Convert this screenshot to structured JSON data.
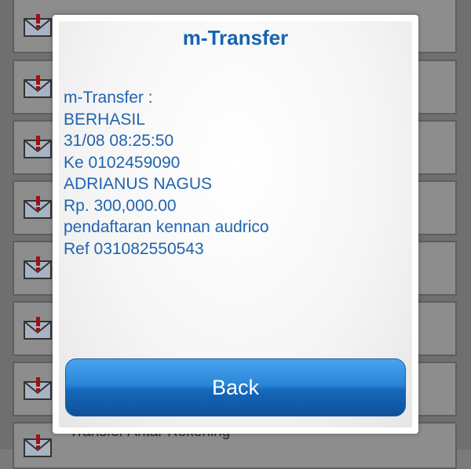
{
  "dialog": {
    "title": "m-Transfer",
    "message_lines": [
      "m-Transfer :",
      "BERHASIL",
      "31/08 08:25:50",
      "Ke 0102459090",
      "ADRIANUS NAGUS",
      "Rp. 300,000.00",
      "pendaftaran kennan audrico",
      "Ref 031082550543"
    ],
    "back_label": "Back"
  },
  "background_list": {
    "last_item_label": "Transfer Antar Rekening"
  },
  "colors": {
    "title": "#1863b0",
    "message_text": "#1f64b0",
    "button_top": "#4aa3ee",
    "button_bottom": "#10509a",
    "overlay": "#6f6f6f"
  },
  "icons": {
    "list_item_icon": "mail-alert-icon"
  }
}
